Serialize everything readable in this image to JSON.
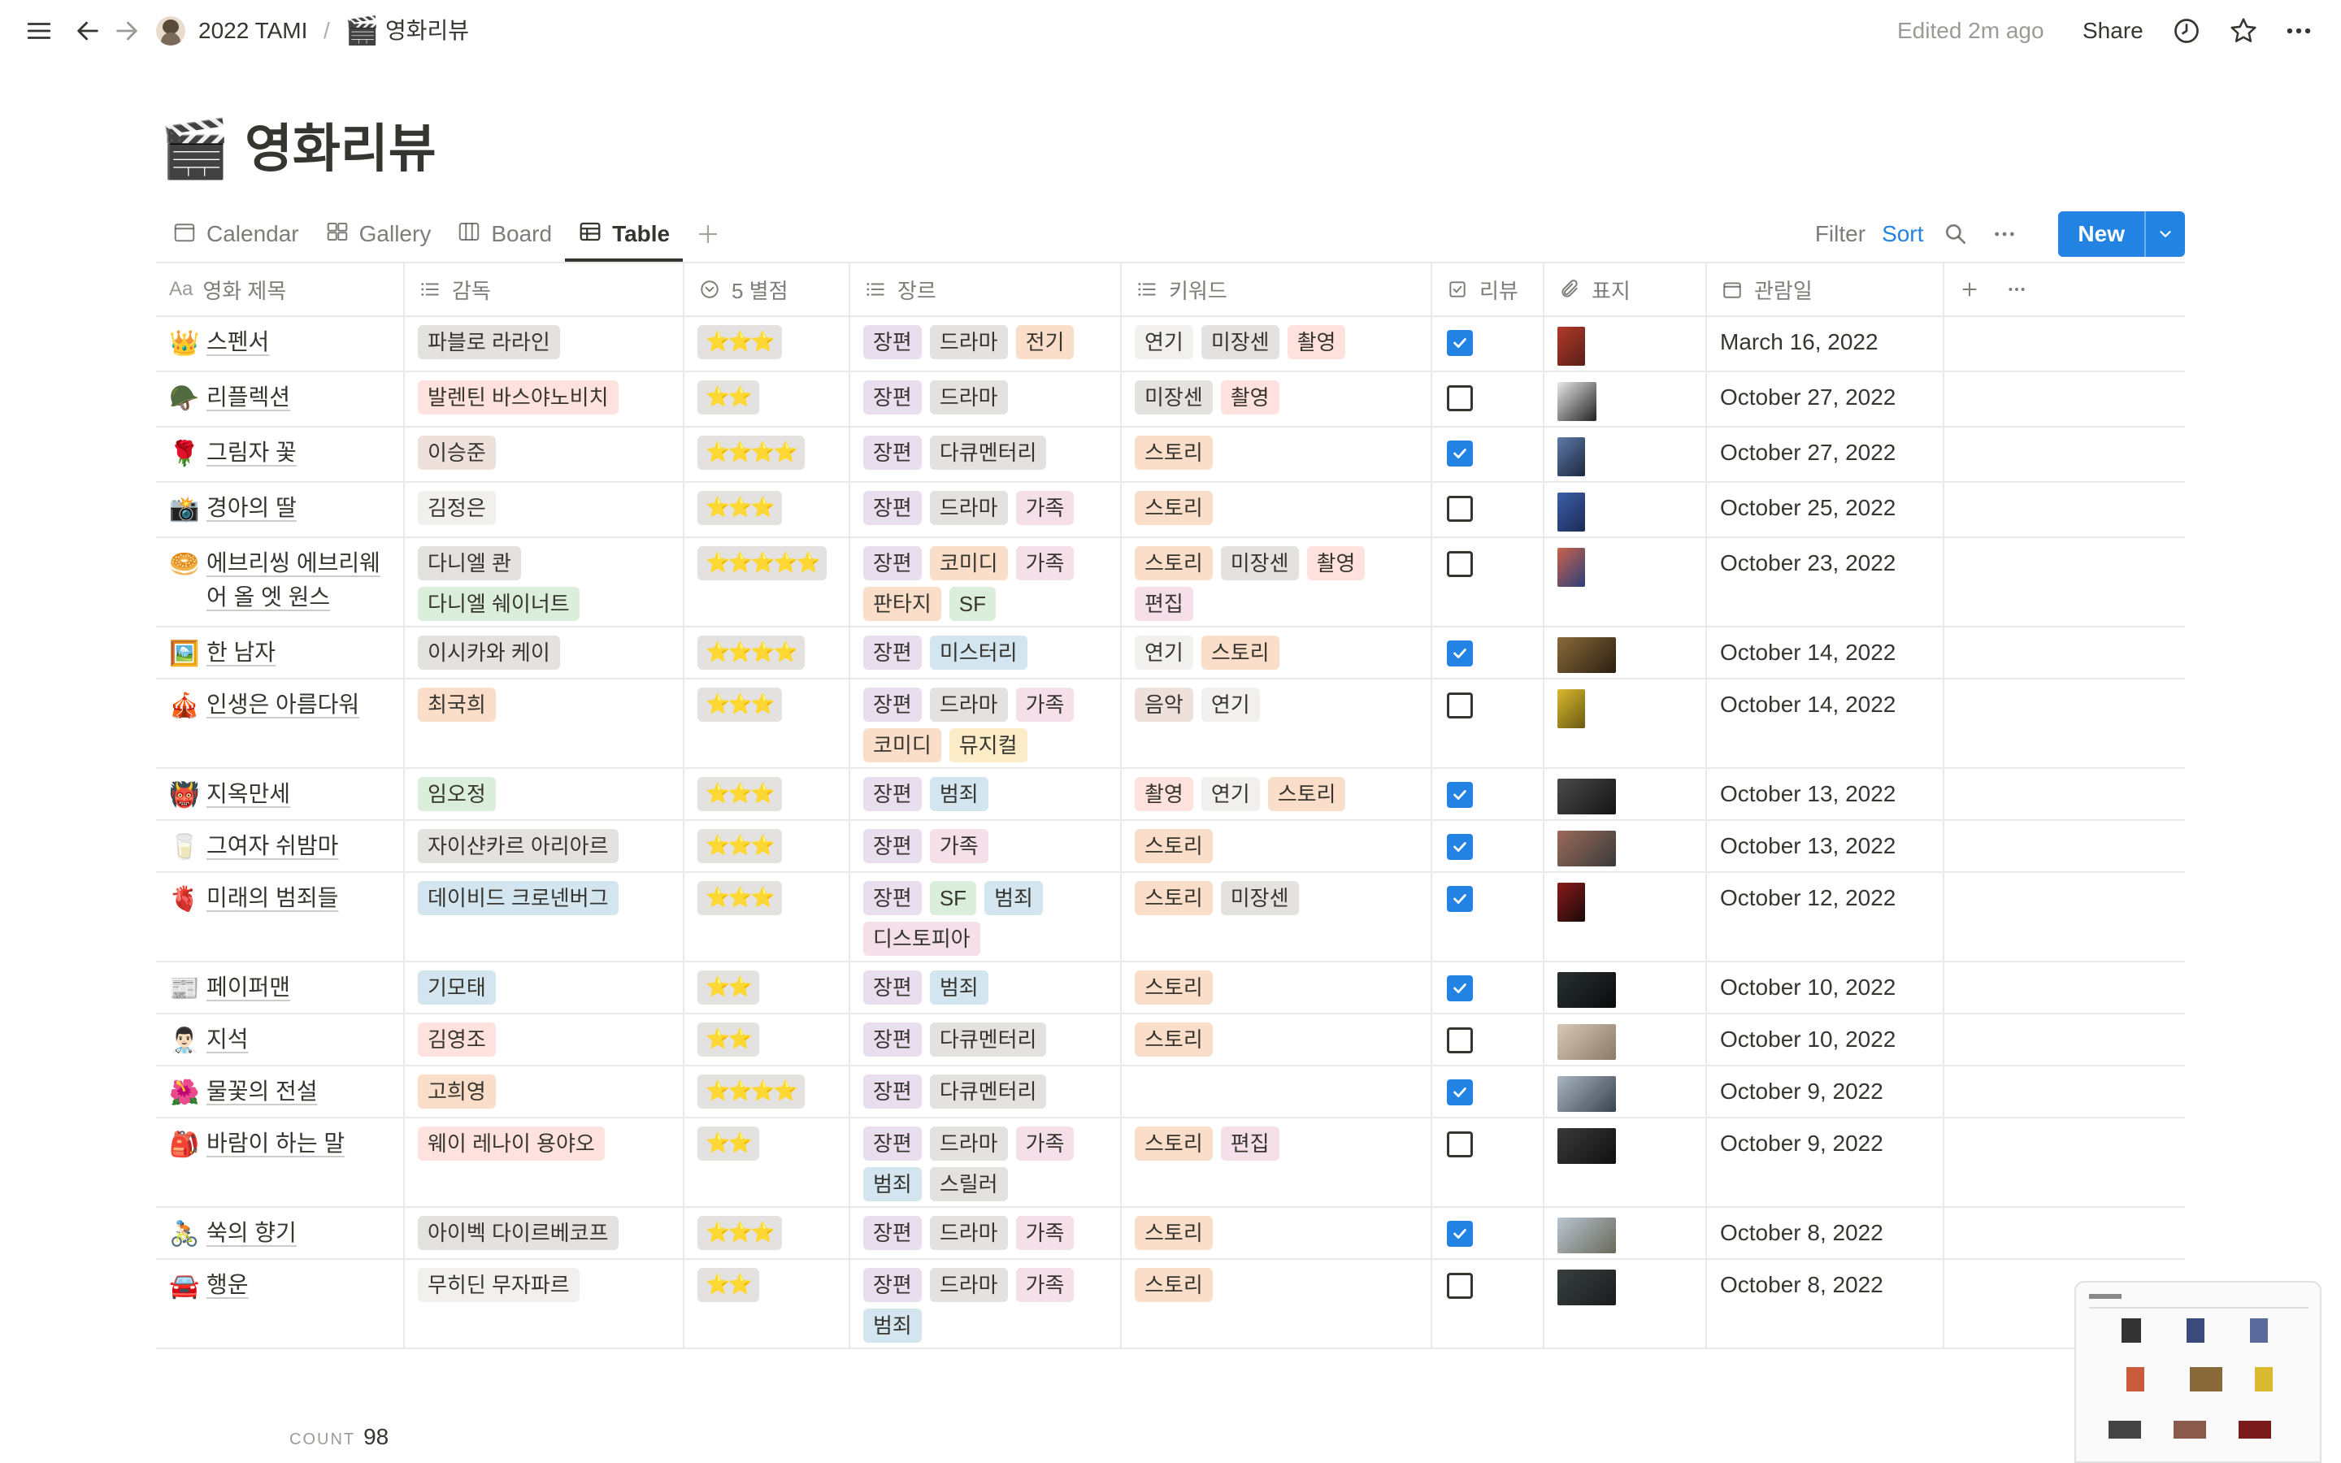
{
  "topbar": {
    "workspace": "2022 TAMI",
    "separator": "/",
    "page_emoji": "🎬",
    "page": "영화리뷰",
    "edited": "Edited 2m ago",
    "share": "Share"
  },
  "page": {
    "emoji": "🎬",
    "title": "영화리뷰"
  },
  "views": [
    {
      "label": "Calendar",
      "icon": "calendar-icon"
    },
    {
      "label": "Gallery",
      "icon": "gallery-icon"
    },
    {
      "label": "Board",
      "icon": "board-icon"
    },
    {
      "label": "Table",
      "icon": "table-icon",
      "active": true
    }
  ],
  "actions": {
    "filter": "Filter",
    "sort": "Sort",
    "new": "New"
  },
  "columns": {
    "title": {
      "prefix": "Aa",
      "label": "영화 제목"
    },
    "director": "감독",
    "rating": "5 별점",
    "genre": "장르",
    "keyword": "키워드",
    "review": "리뷰",
    "cover": "표지",
    "date": "관람일"
  },
  "tag_colors": {
    "장편": "purple",
    "드라마": "gray",
    "전기": "orange",
    "다큐멘터리": "gray",
    "가족": "pink",
    "코미디": "orange",
    "판타지": "orange",
    "SF": "green",
    "미스터리": "blue",
    "뮤지컬": "yellow",
    "범죄": "blue",
    "디스토피아": "pink",
    "스릴러": "gray",
    "연기": "default",
    "미장센": "gray",
    "촬영": "red",
    "스토리": "orange",
    "편집": "pink",
    "음악": "brown"
  },
  "rows": [
    {
      "emoji": "👑",
      "title": "스펜서",
      "directors": [
        {
          "name": "파블로 라라인",
          "color": "gray"
        }
      ],
      "rating": "⭐⭐⭐",
      "genres": [
        "장편",
        "드라마",
        "전기"
      ],
      "keywords": [
        "연기",
        "미장센",
        "촬영"
      ],
      "review": true,
      "cover": [
        "#b23a2a",
        "#5a1f18"
      ],
      "cover_size": "narrow",
      "date": "March 16, 2022"
    },
    {
      "emoji": "🪖",
      "title": "리플렉션",
      "directors": [
        {
          "name": "발렌틴 바스야노비치",
          "color": "red"
        }
      ],
      "rating": "⭐⭐",
      "genres": [
        "장편",
        "드라마"
      ],
      "keywords": [
        "미장센",
        "촬영"
      ],
      "review": false,
      "cover": [
        "#e8e8e8",
        "#222222"
      ],
      "cover_size": "square",
      "date": "October 27, 2022"
    },
    {
      "emoji": "🌹",
      "title": "그림자 꽃",
      "directors": [
        {
          "name": "이승준",
          "color": "brown"
        }
      ],
      "rating": "⭐⭐⭐⭐",
      "genres": [
        "장편",
        "다큐멘터리"
      ],
      "keywords": [
        "스토리"
      ],
      "review": true,
      "cover": [
        "#5d7aa8",
        "#1d2840"
      ],
      "cover_size": "narrow",
      "date": "October 27, 2022"
    },
    {
      "emoji": "📸",
      "title": "경아의 딸",
      "directors": [
        {
          "name": "김정은",
          "color": "default"
        }
      ],
      "rating": "⭐⭐⭐",
      "genres": [
        "장편",
        "드라마",
        "가족"
      ],
      "keywords": [
        "스토리"
      ],
      "review": false,
      "cover": [
        "#3b5fa8",
        "#1c2a55"
      ],
      "cover_size": "narrow",
      "date": "October 25, 2022"
    },
    {
      "emoji": "🥯",
      "title": "에브리씽 에브리웨어 올 엣 원스",
      "directors": [
        {
          "name": "다니엘 콴",
          "color": "gray"
        },
        {
          "name": "다니엘 쉐이너트",
          "color": "green"
        }
      ],
      "rating": "⭐⭐⭐⭐⭐",
      "genres": [
        "장편",
        "코미디",
        "가족",
        "판타지",
        "SF"
      ],
      "keywords": [
        "스토리",
        "미장센",
        "촬영",
        "편집"
      ],
      "review": false,
      "cover": [
        "#c9624a",
        "#2d3f7a"
      ],
      "cover_size": "narrow",
      "date": "October 23, 2022"
    },
    {
      "emoji": "🖼️",
      "title": "한 남자",
      "directors": [
        {
          "name": "이시카와 케이",
          "color": "gray"
        }
      ],
      "rating": "⭐⭐⭐⭐",
      "genres": [
        "장편",
        "미스터리"
      ],
      "keywords": [
        "연기",
        "스토리"
      ],
      "review": true,
      "cover": [
        "#8a6a3a",
        "#2a1f12"
      ],
      "cover_size": "wide",
      "date": "October 14, 2022"
    },
    {
      "emoji": "🎪",
      "title": "인생은 아름다워",
      "directors": [
        {
          "name": "최국희",
          "color": "orange"
        }
      ],
      "rating": "⭐⭐⭐",
      "genres": [
        "장편",
        "드라마",
        "가족",
        "코미디",
        "뮤지컬"
      ],
      "keywords": [
        "음악",
        "연기"
      ],
      "review": false,
      "cover": [
        "#d9b92e",
        "#6a5a12"
      ],
      "cover_size": "narrow",
      "date": "October 14, 2022"
    },
    {
      "emoji": "👹",
      "title": "지옥만세",
      "directors": [
        {
          "name": "임오정",
          "color": "green"
        }
      ],
      "rating": "⭐⭐⭐",
      "genres": [
        "장편",
        "범죄"
      ],
      "keywords": [
        "촬영",
        "연기",
        "스토리"
      ],
      "review": true,
      "cover": [
        "#4a4a4a",
        "#141414"
      ],
      "cover_size": "wide",
      "date": "October 13, 2022"
    },
    {
      "emoji": "🥛",
      "title": "그여자 쉬밤마",
      "directors": [
        {
          "name": "자이샨카르 아리아르",
          "color": "gray"
        }
      ],
      "rating": "⭐⭐⭐",
      "genres": [
        "장편",
        "가족"
      ],
      "keywords": [
        "스토리"
      ],
      "review": true,
      "cover": [
        "#9a6a5a",
        "#3a3a3a"
      ],
      "cover_size": "wide",
      "date": "October 13, 2022"
    },
    {
      "emoji": "🫀",
      "title": "미래의 범죄들",
      "directors": [
        {
          "name": "데이비드 크로넨버그",
          "color": "blue"
        }
      ],
      "rating": "⭐⭐⭐",
      "genres": [
        "장편",
        "SF",
        "범죄",
        "디스토피아"
      ],
      "keywords": [
        "스토리",
        "미장센"
      ],
      "review": true,
      "cover": [
        "#8a1a1a",
        "#1a0a0a"
      ],
      "cover_size": "narrow",
      "date": "October 12, 2022"
    },
    {
      "emoji": "📰",
      "title": "페이퍼맨",
      "directors": [
        {
          "name": "기모태",
          "color": "blue"
        }
      ],
      "rating": "⭐⭐",
      "genres": [
        "장편",
        "범죄"
      ],
      "keywords": [
        "스토리"
      ],
      "review": true,
      "cover": [
        "#2a3030",
        "#0a0c0c"
      ],
      "cover_size": "wide",
      "date": "October 10, 2022"
    },
    {
      "emoji": "👨🏻‍⚕️",
      "title": "지석",
      "directors": [
        {
          "name": "김영조",
          "color": "red"
        }
      ],
      "rating": "⭐⭐",
      "genres": [
        "장편",
        "다큐멘터리"
      ],
      "keywords": [
        "스토리"
      ],
      "review": false,
      "cover": [
        "#d8c8b8",
        "#8a7a6a"
      ],
      "cover_size": "wide",
      "date": "October 10, 2022"
    },
    {
      "emoji": "🌺",
      "title": "물꽃의 전설",
      "directors": [
        {
          "name": "고희영",
          "color": "orange"
        }
      ],
      "rating": "⭐⭐⭐⭐",
      "genres": [
        "장편",
        "다큐멘터리"
      ],
      "keywords": [],
      "review": true,
      "cover": [
        "#a8b4c0",
        "#3a4450"
      ],
      "cover_size": "wide",
      "date": "October 9, 2022"
    },
    {
      "emoji": "🎒",
      "title": "바람이 하는 말",
      "directors": [
        {
          "name": "웨이 레나이 용야오",
          "color": "red"
        }
      ],
      "rating": "⭐⭐",
      "genres": [
        "장편",
        "드라마",
        "가족",
        "범죄",
        "스릴러"
      ],
      "keywords": [
        "스토리",
        "편집"
      ],
      "review": false,
      "cover": [
        "#3a3a3a",
        "#101010"
      ],
      "cover_size": "wide",
      "date": "October 9, 2022"
    },
    {
      "emoji": "🚴🏻",
      "title": "쑥의 향기",
      "directors": [
        {
          "name": "아이벡 다이르베코프",
          "color": "gray"
        }
      ],
      "rating": "⭐⭐⭐",
      "genres": [
        "장편",
        "드라마",
        "가족"
      ],
      "keywords": [
        "스토리"
      ],
      "review": true,
      "cover": [
        "#b8c4d0",
        "#6a6a5a"
      ],
      "cover_size": "wide",
      "date": "October 8, 2022"
    },
    {
      "emoji": "🚘",
      "title": "행운",
      "directors": [
        {
          "name": "무히딘 무자파르",
          "color": "default"
        }
      ],
      "rating": "⭐⭐",
      "genres": [
        "장편",
        "드라마",
        "가족",
        "범죄"
      ],
      "keywords": [
        "스토리"
      ],
      "review": false,
      "cover": [
        "#3a4040",
        "#1a1c1c"
      ],
      "cover_size": "wide",
      "date": "October 8, 2022"
    }
  ],
  "footer": {
    "count_label": "COUNT",
    "count_value": "98"
  }
}
